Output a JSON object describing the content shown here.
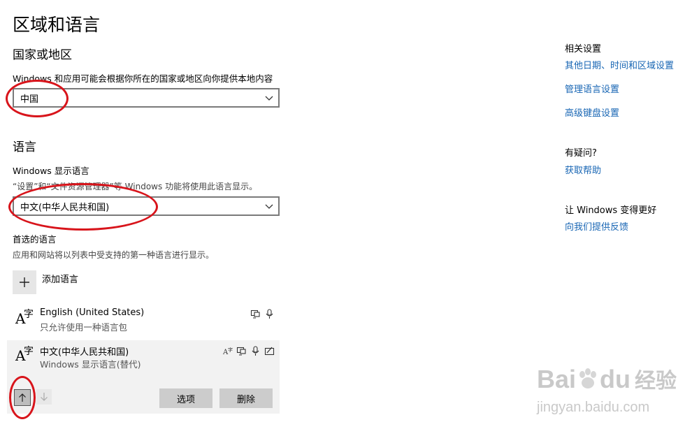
{
  "page_title": "区域和语言",
  "region": {
    "heading": "国家或地区",
    "description": "Windows 和应用可能会根据你所在的国家或地区向你提供本地内容",
    "selected": "中国"
  },
  "language": {
    "heading": "语言",
    "display_label": "Windows 显示语言",
    "display_desc": "“设置”和“文件资源管理器”等 Windows 功能将使用此语言显示。",
    "display_selected": "中文(中华人民共和国)",
    "preferred_label": "首选的语言",
    "preferred_desc": "应用和网站将以列表中受支持的第一种语言进行显示。",
    "add_label": "添加语言",
    "items": [
      {
        "name": "English (United States)",
        "sub": "只允许使用一种语言包"
      },
      {
        "name": "中文(中华人民共和国)",
        "sub": "Windows 显示语言(替代)"
      }
    ],
    "options_label": "选项",
    "remove_label": "删除"
  },
  "sidebar": {
    "related_heading": "相关设置",
    "links": [
      "其他日期、时间和区域设置",
      "管理语言设置",
      "高级键盘设置"
    ],
    "question_heading": "有疑问?",
    "help_link": "获取帮助",
    "feedback_heading": "让 Windows 变得更好",
    "feedback_link": "向我们提供反馈"
  },
  "watermark": {
    "brand_left": "Bai",
    "brand_right": "du",
    "brand_cn": "经验",
    "url": "jingyan.baidu.com"
  },
  "colors": {
    "link": "#1866b4",
    "annotation": "#d8141b",
    "button": "#cccccc"
  }
}
